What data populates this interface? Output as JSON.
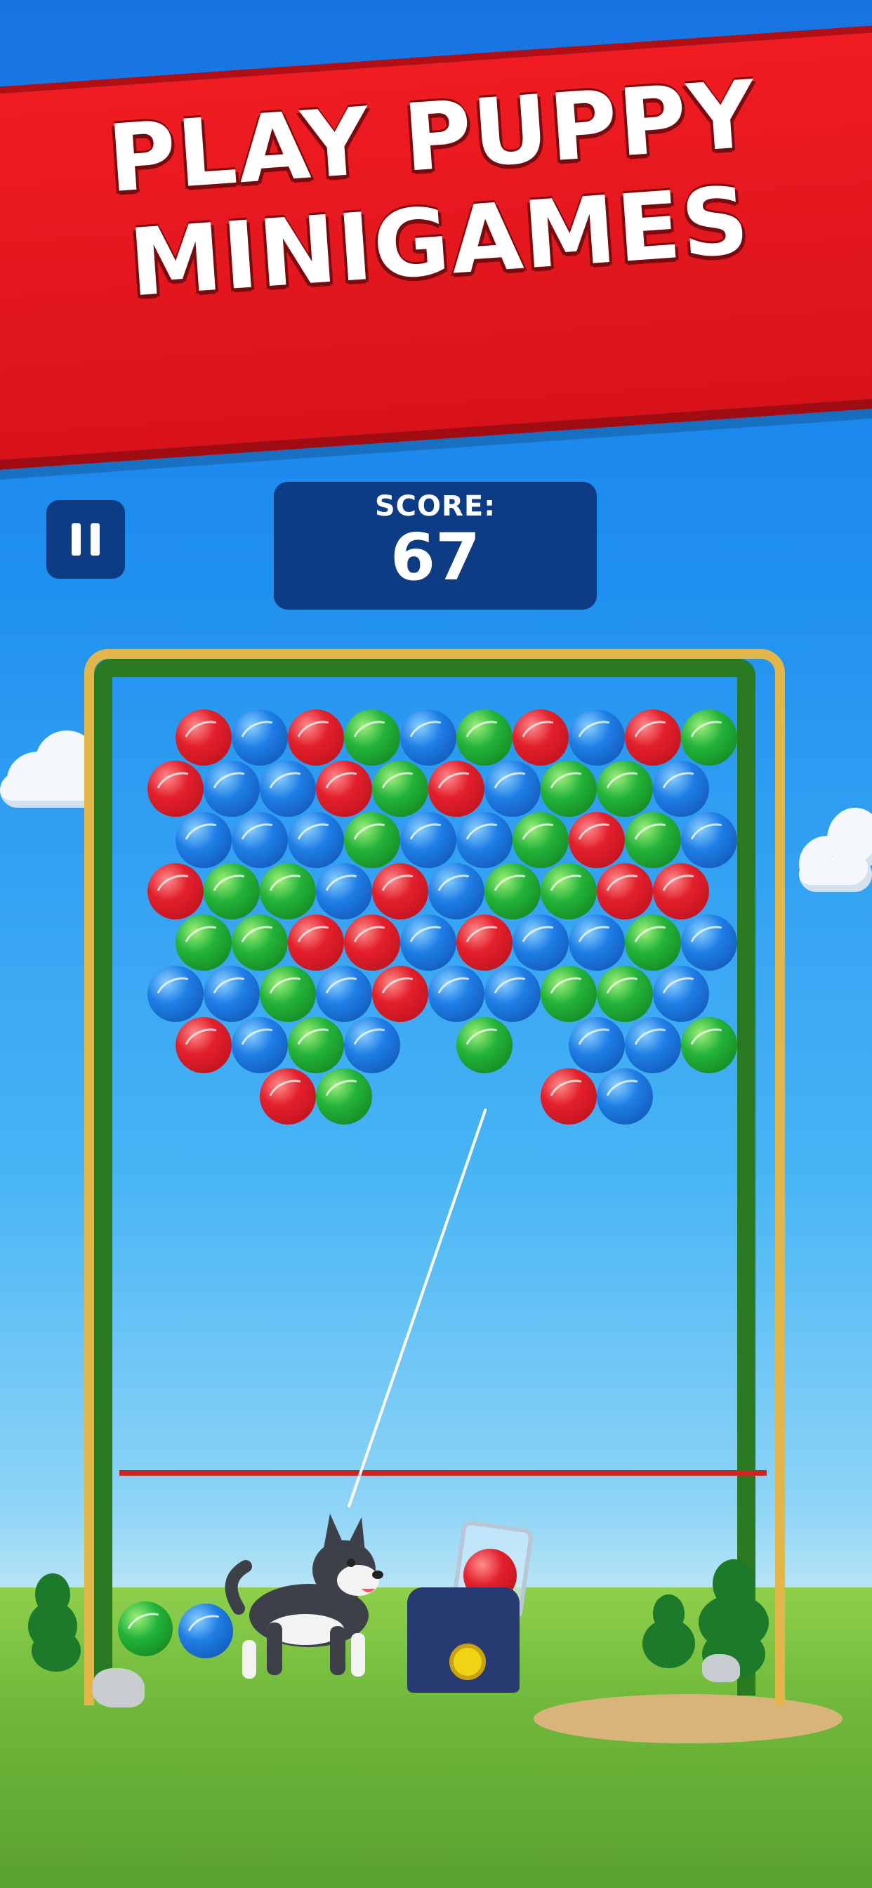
{
  "banner": {
    "line1": "PLAY PUPPY",
    "line2": "MINIGAMES"
  },
  "hud": {
    "pause_icon": "pause-icon",
    "score_label": "SCORE:",
    "score_value": "67"
  },
  "colors": {
    "banner_red": "#e3161d",
    "hud_navy": "#0d3c85",
    "ball_red": "#e3202c",
    "ball_green": "#23b33a",
    "ball_blue": "#1f7ee6",
    "frame_gold": "#e3b64a",
    "frame_green": "#2a7a22"
  },
  "board": {
    "rows": [
      [
        "red",
        "blue",
        "red",
        "green",
        "blue",
        "green",
        "red",
        "blue",
        "red",
        "green"
      ],
      [
        "red",
        "blue",
        "blue",
        "red",
        "green",
        "red",
        "blue",
        "green",
        "green",
        "blue"
      ],
      [
        "blue",
        "blue",
        "blue",
        "green",
        "blue",
        "blue",
        "green",
        "red",
        "green",
        "blue"
      ],
      [
        "red",
        "green",
        "green",
        "blue",
        "red",
        "blue",
        "green",
        "green",
        "red",
        "red"
      ],
      [
        "green",
        "green",
        "red",
        "red",
        "blue",
        "red",
        "blue",
        "blue",
        "green",
        "blue"
      ],
      [
        "blue",
        "blue",
        "green",
        "blue",
        "red",
        "blue",
        "blue",
        "green",
        "green",
        "blue"
      ],
      [
        "red",
        "blue",
        "green",
        "blue",
        "",
        "green",
        "",
        "blue",
        "blue",
        "green"
      ],
      [
        "",
        "",
        "red",
        "green",
        "",
        "",
        "",
        "red",
        "blue",
        ""
      ]
    ]
  },
  "shooter": {
    "loaded_ball": "red"
  },
  "ground_balls": [
    "green",
    "blue"
  ]
}
